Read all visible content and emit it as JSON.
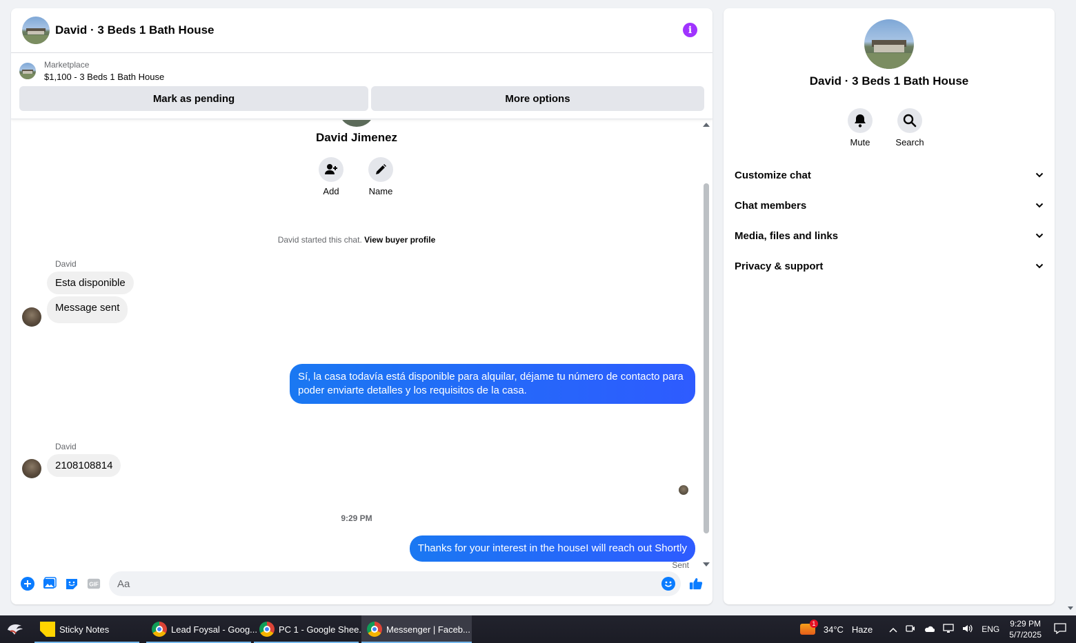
{
  "chat": {
    "title": "David · 3 Beds 1 Bath House",
    "marketplace": {
      "label": "Marketplace",
      "item": "$1,100 - 3 Beds 1 Bath House",
      "pending_button": "Mark as pending",
      "more_button": "More options"
    },
    "profile": {
      "name": "David Jimenez",
      "add_label": "Add",
      "name_label": "Name"
    },
    "system_text": "David started this chat.",
    "system_link": "View buyer profile",
    "messages": [
      {
        "sender": "David",
        "text": "Esta disponible"
      },
      {
        "text": "Message sent"
      },
      {
        "text_line1": "Sí, la casa todavía está disponible para alquilar, déjame tu número de contacto para",
        "text_line2": "poder enviarte detalles y los requisitos de la casa."
      },
      {
        "sender": "David",
        "text": "2108108814"
      },
      {
        "time": "9:29 PM"
      },
      {
        "text": "Thanks for your interest in the houseI will reach out Shortly",
        "status": "Sent"
      }
    ],
    "composer": {
      "placeholder": "Aa"
    }
  },
  "info": {
    "title": "David · 3 Beds 1 Bath House",
    "mute_label": "Mute",
    "search_label": "Search",
    "sections": [
      "Customize chat",
      "Chat members",
      "Media, files and links",
      "Privacy & support"
    ]
  },
  "taskbar": {
    "items": [
      "Sticky Notes",
      "Lead Foysal - Goog...",
      "PC 1 - Google Shee...",
      "Messenger | Faceb..."
    ],
    "weather_badge": "1",
    "weather": "34°C",
    "weather_desc": "Haze",
    "lang": "ENG",
    "time": "9:29 PM",
    "date": "5/7/2025"
  },
  "colors": {
    "accent": "#0a7cff",
    "info_icon": "#a033ff",
    "bubble_in": "#f0f0f0"
  }
}
